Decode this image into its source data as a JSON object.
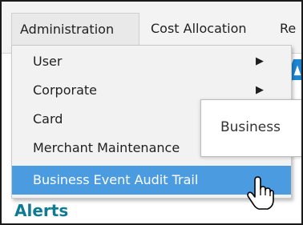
{
  "menubar": {
    "tabs": [
      {
        "label": "Administration"
      },
      {
        "label": "Cost Allocation"
      },
      {
        "label": "Re"
      }
    ]
  },
  "dropdown": {
    "items": [
      {
        "label": "User",
        "submenu_arrow": "▶"
      },
      {
        "label": "Corporate",
        "submenu_arrow": "▶"
      },
      {
        "label": "Card"
      },
      {
        "label": "Merchant Maintenance"
      },
      {
        "label": "Business Event Audit Trail",
        "highlighted": true
      }
    ]
  },
  "popup": {
    "text": "Business"
  },
  "page": {
    "heading": "Alerts"
  },
  "colors": {
    "highlight": "#4a9be0",
    "alerts_text": "#0e7a94",
    "menu_bg": "#f2f2f2"
  },
  "icons": {
    "cursor": "hand-pointer-icon"
  }
}
